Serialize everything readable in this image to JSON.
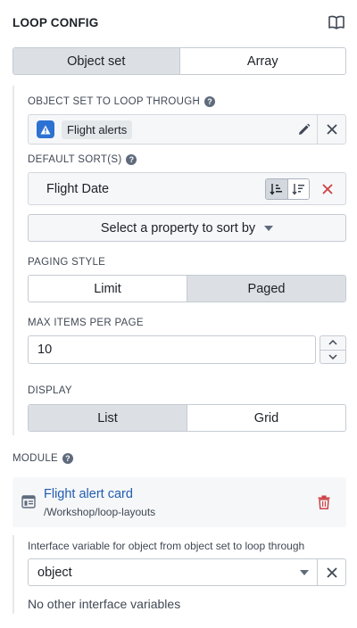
{
  "header": {
    "title": "LOOP CONFIG",
    "icon": "book-icon"
  },
  "loop_type": {
    "options": [
      "Object set",
      "Array"
    ],
    "selected": "Object set"
  },
  "object_set": {
    "label": "OBJECT SET TO LOOP THROUGH",
    "value": "Flight alerts",
    "icon": "warning-icon",
    "accent": "#2d72d2"
  },
  "default_sort": {
    "label": "DEFAULT SORT(S)",
    "items": [
      {
        "property": "Flight Date",
        "direction": "ascending"
      }
    ],
    "add_placeholder": "Select a property to sort by"
  },
  "paging": {
    "label": "PAGING STYLE",
    "options": [
      "Limit",
      "Paged"
    ],
    "selected": "Paged"
  },
  "max_items": {
    "label": "MAX ITEMS PER PAGE",
    "value": "10"
  },
  "display": {
    "label": "DISPLAY",
    "options": [
      "List",
      "Grid"
    ],
    "selected": "List"
  },
  "module": {
    "label": "MODULE",
    "name": "Flight alert card",
    "path": "/Workshop/loop-layouts",
    "link_color": "#215db0",
    "danger_color": "#cd4246"
  },
  "interface_variable": {
    "label": "Interface variable for object from object set to loop through",
    "value": "object",
    "note": "No other interface variables"
  }
}
